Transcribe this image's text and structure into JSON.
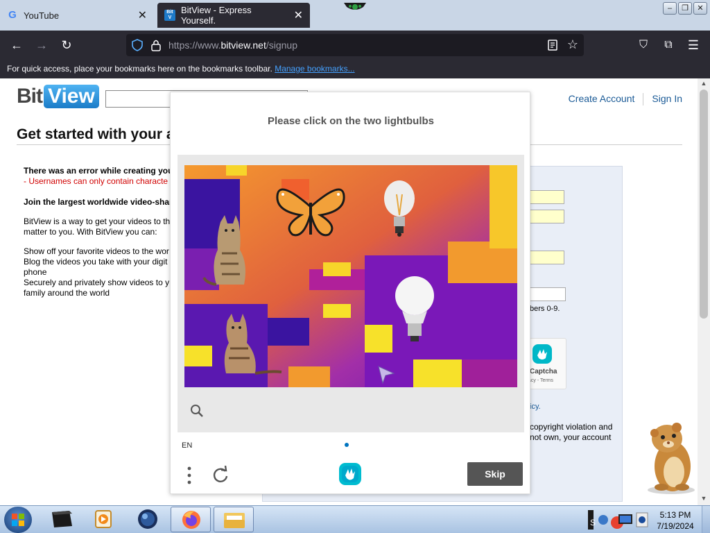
{
  "browser": {
    "tabs": [
      {
        "title": "YouTube",
        "favicon": "google-icon",
        "active": false
      },
      {
        "title": "BitView - Express Yourself.",
        "favicon": "bitview-favicon",
        "active": true
      }
    ],
    "url": {
      "prefix": "https://www.",
      "host": "bitview.net",
      "path": "/signup"
    },
    "bookmarks_bar": {
      "text": "For quick access, place your bookmarks here on the bookmarks toolbar.",
      "link": "Manage bookmarks..."
    }
  },
  "site": {
    "logo": {
      "part1": "Bit",
      "part2": "View"
    },
    "header_links": [
      "Create Account",
      "Sign In"
    ],
    "page_title": "Get started with your a",
    "error_title": "There was an error while creating you",
    "error_message": "- Usernames can only contain characte",
    "join_heading": "Join the largest worldwide video-shar",
    "intro": "BitView is a way to get your videos to th\nmatter to you. With BitView you can:",
    "features": "Show off your favorite videos to the wor\nBlog the videos you take with your digit\nphone\nSecurely and privately show videos to y\nfamily around the world",
    "form_note": "bers 0-9.",
    "captcha_badge": {
      "label": "Captcha",
      "sub": "acy - Terms"
    },
    "policy_link": "icy.",
    "copyright_text": "copyright violation and\nnot own, your account"
  },
  "captcha": {
    "prompt": "Please click on the two lightbulbs",
    "language": "EN",
    "skip_label": "Skip",
    "accent": "#0074bf"
  },
  "taskbar": {
    "time": "5:13 PM",
    "date": "7/19/2024"
  }
}
